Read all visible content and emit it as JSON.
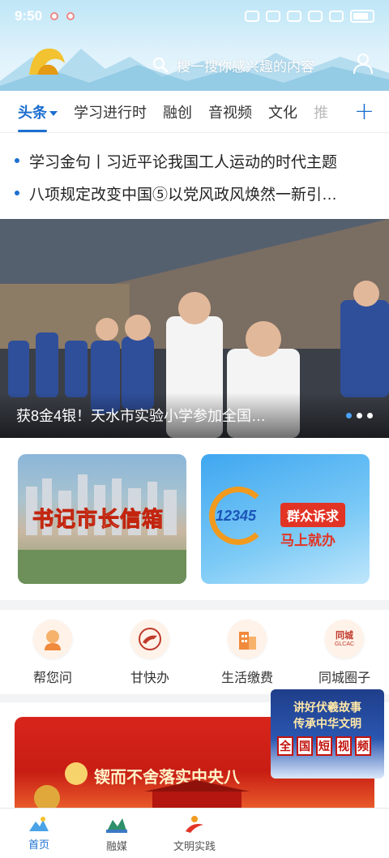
{
  "status_bar": {
    "time": "9:50"
  },
  "header": {
    "search_placeholder": "搜一搜你感兴趣的内容"
  },
  "tabs": [
    {
      "label": "头条",
      "active": true
    },
    {
      "label": "学习进行时"
    },
    {
      "label": "融创"
    },
    {
      "label": "音视频"
    },
    {
      "label": "文化"
    },
    {
      "label": "推"
    }
  ],
  "headlines": [
    "学习金句丨习近平论我国工人运动的时代主题",
    "八项规定改变中国⑤以党风政风焕然一新引…"
  ],
  "banner": {
    "caption": "获8金4银！天水市实验小学参加全国…",
    "pager_count": 3
  },
  "service_cards": {
    "left": {
      "title": "书记市长信箱"
    },
    "right": {
      "number": "12345",
      "pill": "群众诉求",
      "sub": "马上就办"
    }
  },
  "quick_services": [
    {
      "label": "帮您问",
      "icon": "person-icon"
    },
    {
      "label": "甘快办",
      "icon": "horse-icon"
    },
    {
      "label": "生活缴费",
      "icon": "building-icon"
    },
    {
      "label": "同城圈子",
      "icon": "city-circle-icon",
      "badge": "同城",
      "badge_sub": "GLCAC"
    }
  ],
  "promo": {
    "text": "锲而不舍落实中央八"
  },
  "float_ad": {
    "line1": "讲好伏羲故事",
    "line2": "传承中华文明",
    "boxes": [
      "全",
      "国",
      "短",
      "视",
      "频"
    ]
  },
  "bottom_nav": [
    {
      "label": "首页",
      "active": true
    },
    {
      "label": "融媒"
    },
    {
      "label": "文明实践"
    }
  ],
  "colors": {
    "accent": "#1b6fd0",
    "red": "#d8251b",
    "orange": "#f29a1e"
  }
}
